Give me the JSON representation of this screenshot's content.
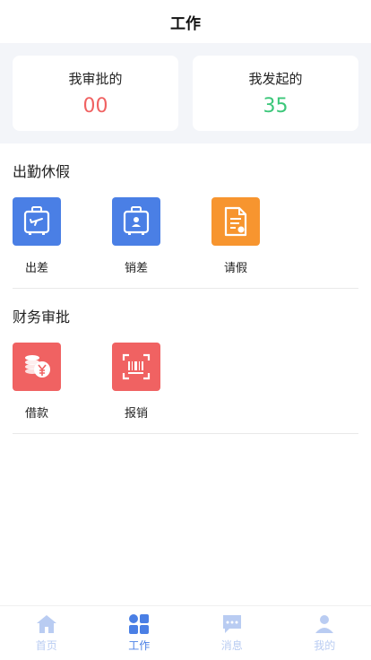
{
  "header": {
    "title": "工作"
  },
  "stats": [
    {
      "label": "我审批的",
      "value": "00",
      "color": "#f06262"
    },
    {
      "label": "我发起的",
      "value": "35",
      "color": "#3cc77a"
    }
  ],
  "sections": [
    {
      "title": "出勤休假",
      "items": [
        {
          "label": "出差",
          "icon": "suitcase-plane-icon",
          "color": "#4a7fe5"
        },
        {
          "label": "销差",
          "icon": "suitcase-person-icon",
          "color": "#4a7fe5"
        },
        {
          "label": "请假",
          "icon": "leave-document-icon",
          "color": "#f7952f"
        }
      ]
    },
    {
      "title": "财务审批",
      "items": [
        {
          "label": "借款",
          "icon": "coins-yen-icon",
          "color": "#f06262"
        },
        {
          "label": "报销",
          "icon": "receipt-scan-icon",
          "color": "#f06262"
        }
      ]
    }
  ],
  "tabbar": {
    "active_color": "#4a7fe5",
    "inactive_color": "#b9ccf2",
    "items": [
      {
        "label": "首页",
        "icon": "home-icon",
        "active": false
      },
      {
        "label": "工作",
        "icon": "apps-grid-icon",
        "active": true
      },
      {
        "label": "消息",
        "icon": "message-icon",
        "active": false
      },
      {
        "label": "我的",
        "icon": "user-icon",
        "active": false
      }
    ]
  }
}
